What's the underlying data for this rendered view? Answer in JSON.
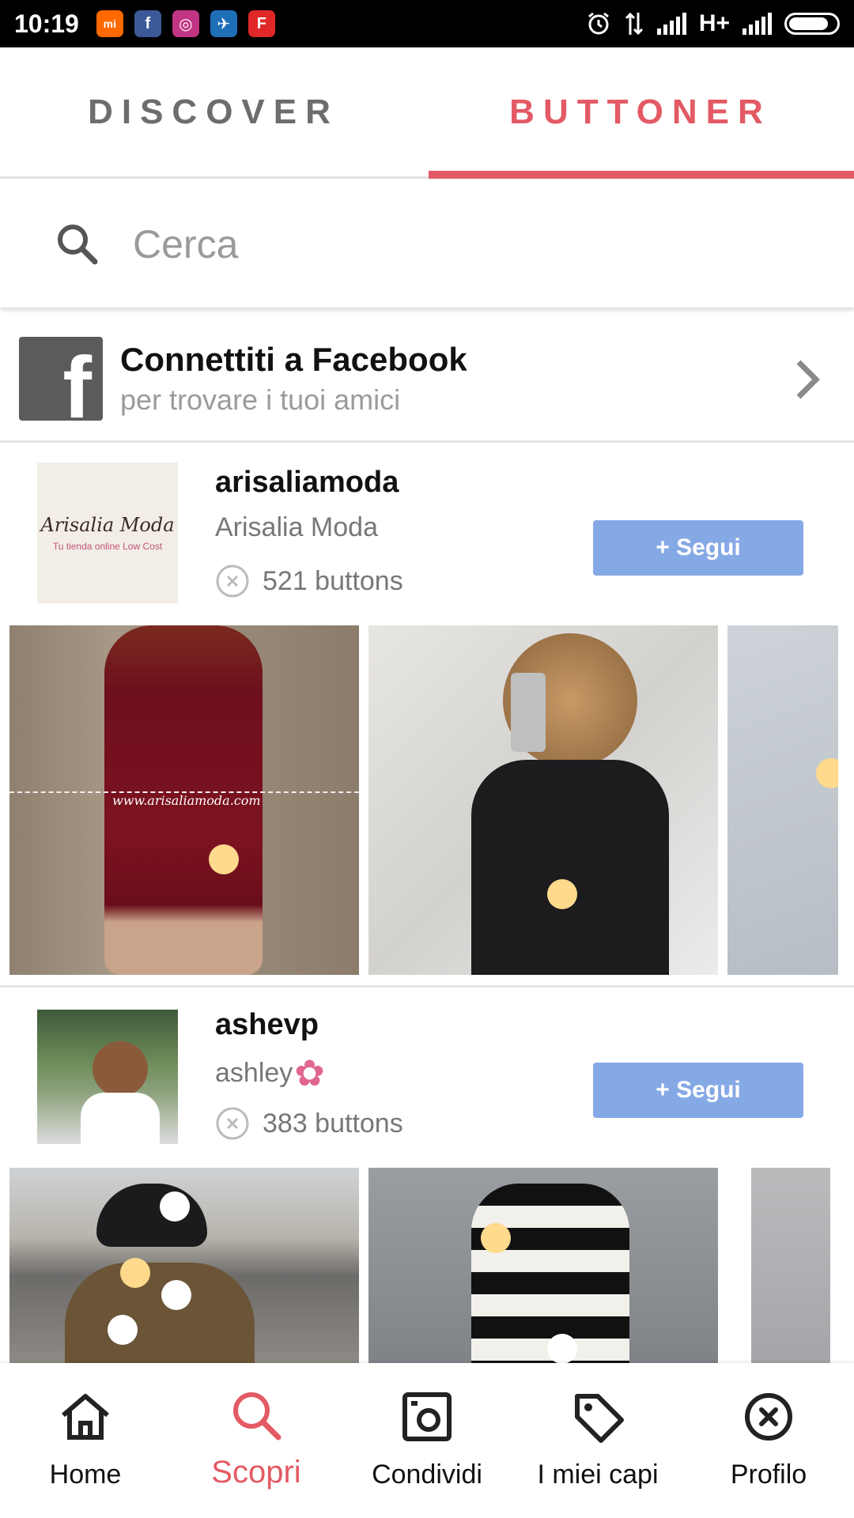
{
  "status_bar": {
    "time": "10:19",
    "network": "H+",
    "app_icons": [
      {
        "name": "mi-icon",
        "label": "mi",
        "color": "#ff6900"
      },
      {
        "name": "facebook-icon",
        "label": "f",
        "color": "#3b5998"
      },
      {
        "name": "instagram-icon",
        "label": "◎",
        "color": "#c13584"
      },
      {
        "name": "app-icon",
        "label": "✈",
        "color": "#1e6fb8"
      },
      {
        "name": "flipboard-icon",
        "label": "F",
        "color": "#e12828"
      }
    ]
  },
  "tabs": {
    "discover": "DISCOVER",
    "buttoner": "BUTTONER",
    "active": "buttoner"
  },
  "search": {
    "placeholder": "Cerca"
  },
  "facebook_connect": {
    "title": "Connettiti a Facebook",
    "subtitle": "per trovare i tuoi amici"
  },
  "users": [
    {
      "username": "arisaliamoda",
      "display_name": "Arisalia Moda",
      "buttons_count": "521 buttons",
      "follow_label": "+ Segui",
      "avatar_text": "Arisalia Moda",
      "avatar_subtext": "Tu tienda online Low Cost",
      "photo_caption": "www.arisaliamoda.com"
    },
    {
      "username": "ashevp",
      "display_name": "ashley",
      "display_name_emoji": "✿",
      "buttons_count": "383 buttons",
      "follow_label": "+ Segui"
    }
  ],
  "bottom_nav": {
    "items": [
      {
        "label": "Home",
        "icon": "home-icon"
      },
      {
        "label": "Scopri",
        "icon": "search-icon"
      },
      {
        "label": "Condividi",
        "icon": "camera-icon"
      },
      {
        "label": "I miei capi",
        "icon": "tag-icon"
      },
      {
        "label": "Profilo",
        "icon": "button-icon"
      }
    ],
    "active": "Scopri"
  },
  "colors": {
    "accent": "#e35a64",
    "follow_button": "#85a9e5",
    "button_dot": "#ffd98c"
  }
}
